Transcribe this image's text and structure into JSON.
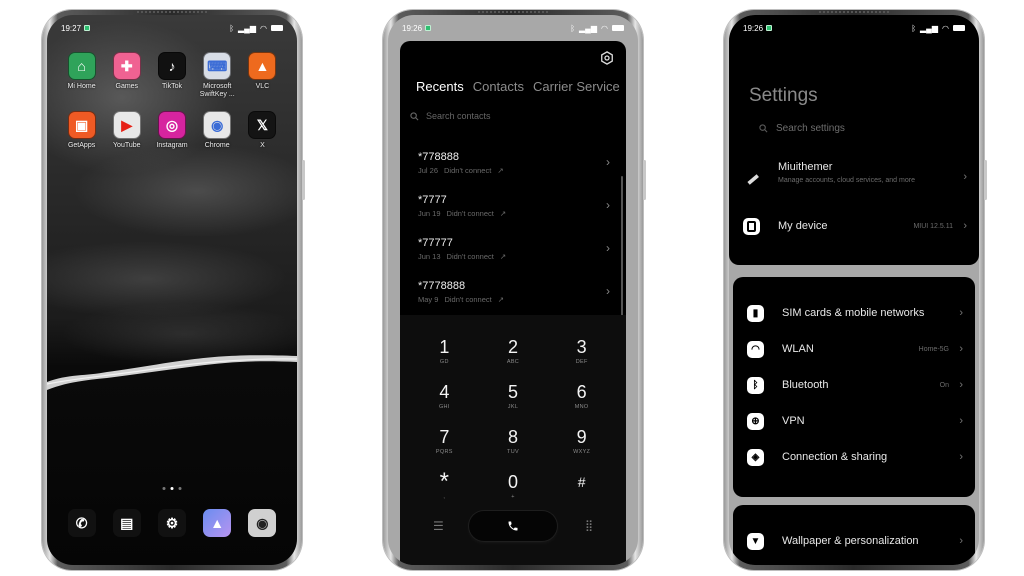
{
  "home": {
    "status": {
      "time": "19:27"
    },
    "apps": [
      {
        "label": "Mi Home",
        "icon": "mi-home-icon",
        "glyph": "⌂",
        "bg": "#2fa35a"
      },
      {
        "label": "Games",
        "icon": "games-icon",
        "glyph": "✚",
        "bg": "#f06292"
      },
      {
        "label": "TikTok",
        "icon": "tiktok-icon",
        "glyph": "♪",
        "bg": "#111111"
      },
      {
        "label": "Microsoft SwiftKey ...",
        "icon": "swiftkey-icon",
        "glyph": "⌨",
        "bg": "#d8dde6"
      },
      {
        "label": "VLC",
        "icon": "vlc-icon",
        "glyph": "▲",
        "bg": "#ee6a1e"
      },
      {
        "label": "GetApps",
        "icon": "getapps-icon",
        "glyph": "▣",
        "bg": "#ef5a24"
      },
      {
        "label": "YouTube",
        "icon": "youtube-icon",
        "glyph": "▶",
        "bg": "#e8e8e8"
      },
      {
        "label": "Instagram",
        "icon": "instagram-icon",
        "glyph": "◎",
        "bg": "#d6249f"
      },
      {
        "label": "Chrome",
        "icon": "chrome-icon",
        "glyph": "◉",
        "bg": "#e8e8e8"
      },
      {
        "label": "X",
        "icon": "x-icon",
        "glyph": "𝕏",
        "bg": "#141414"
      }
    ],
    "page_indicator": {
      "pages": 3,
      "active": 2
    },
    "dock": [
      {
        "name": "phone",
        "icon": "phone-icon",
        "glyph": "✆"
      },
      {
        "name": "messages",
        "icon": "messages-icon",
        "glyph": "▤"
      },
      {
        "name": "settings",
        "icon": "settings-icon",
        "glyph": "⚙"
      },
      {
        "name": "gallery",
        "icon": "gallery-icon",
        "glyph": "▲"
      },
      {
        "name": "camera",
        "icon": "camera-icon",
        "glyph": "◉"
      }
    ]
  },
  "dialer": {
    "status": {
      "time": "19:26"
    },
    "tabs": [
      "Recents",
      "Contacts",
      "Carrier Service"
    ],
    "active_tab": "Recents",
    "search_placeholder": "Search contacts",
    "recents": [
      {
        "number": "*778888",
        "date": "Jul 26",
        "status": "Didn't connect"
      },
      {
        "number": "*7777",
        "date": "Jun 19",
        "status": "Didn't connect"
      },
      {
        "number": "*77777",
        "date": "Jun 13",
        "status": "Didn't connect"
      },
      {
        "number": "*7778888",
        "date": "May 9",
        "status": "Didn't connect"
      }
    ],
    "keys": [
      {
        "digit": "1",
        "letters": "GD"
      },
      {
        "digit": "2",
        "letters": "ABC"
      },
      {
        "digit": "3",
        "letters": "DEF"
      },
      {
        "digit": "4",
        "letters": "GHI"
      },
      {
        "digit": "5",
        "letters": "JKL"
      },
      {
        "digit": "6",
        "letters": "MNO"
      },
      {
        "digit": "7",
        "letters": "PQRS"
      },
      {
        "digit": "8",
        "letters": "TUV"
      },
      {
        "digit": "9",
        "letters": "WXYZ"
      },
      {
        "digit": "*",
        "letters": ","
      },
      {
        "digit": "0",
        "letters": "+"
      },
      {
        "digit": "#",
        "letters": ""
      }
    ]
  },
  "settings": {
    "status": {
      "time": "19:26"
    },
    "title": "Settings",
    "search_placeholder": "Search settings",
    "account": {
      "label": "Miuithemer",
      "sub": "Manage accounts, cloud services, and more"
    },
    "my_device": {
      "label": "My device",
      "value": "MIUI 12.5.11"
    },
    "network_items": [
      {
        "label": "SIM cards & mobile networks",
        "value": "",
        "icon": "sim-card-icon",
        "glyph": "▮"
      },
      {
        "label": "WLAN",
        "value": "Home-5G",
        "icon": "wifi-icon",
        "glyph": "◠"
      },
      {
        "label": "Bluetooth",
        "value": "On",
        "icon": "bluetooth-icon",
        "glyph": "ᛒ"
      },
      {
        "label": "VPN",
        "value": "",
        "icon": "vpn-icon",
        "glyph": "⊕"
      },
      {
        "label": "Connection & sharing",
        "value": "",
        "icon": "connection-sharing-icon",
        "glyph": "◈"
      }
    ],
    "wallpaper": {
      "label": "Wallpaper & personalization"
    }
  }
}
